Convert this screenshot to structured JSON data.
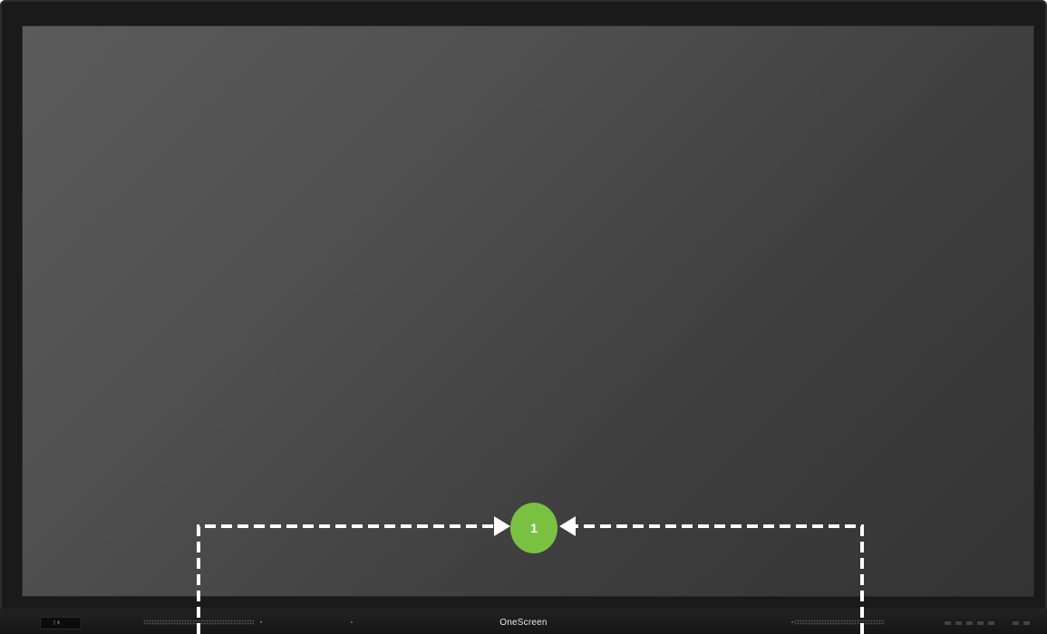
{
  "device": {
    "brand": "OneScreen",
    "colors": {
      "bezel": "#1a1a1a",
      "screen_light": "#5b5b5b",
      "screen_dark": "#333333",
      "callout": "#7ac142",
      "connector": "#ffffff"
    }
  },
  "callout": {
    "number": "1"
  }
}
